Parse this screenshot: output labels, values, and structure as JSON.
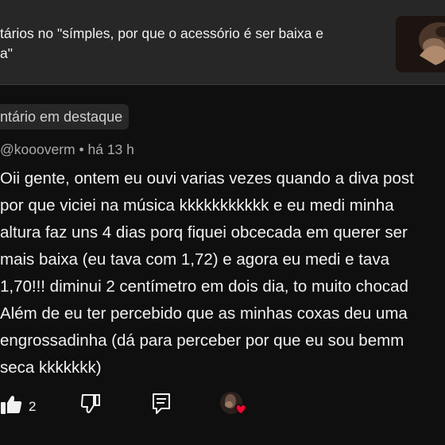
{
  "header": {
    "video_title_line1": "tários no \"símples, por que o acessório é ser baixa e",
    "video_title_line2": "a\""
  },
  "pinned_label": "ntário em destaque",
  "comment": {
    "author": "@koooverm",
    "separator": "•",
    "time": "há 13 h",
    "lines": [
      "Oii gente, ontem eu ouvi varias vezes quando a diva post",
      "por que viciei na música kkkkkkkkkkk e eu medi minha",
      "altura faz uns 4 dias porq fiquei obcecada em querer ser",
      "mais baixa (eu tava com 1,72) e agora eu medi e tava",
      "1,70!!! diminui 2 centímetro em dois dia, to muito chocad",
      "Além de eu ter percebido que as minhas coxas deu uma",
      "engrossadinha (dá para perceber por que eu sou bemm",
      "seca kkkkkkk)"
    ]
  },
  "actions": {
    "like_count": "2"
  },
  "colors": {
    "background": "#0f0f0f",
    "card": "#272727",
    "text": "#f1f1f1",
    "secondary_text": "#aaaaaa",
    "heart": "#ff0033"
  }
}
